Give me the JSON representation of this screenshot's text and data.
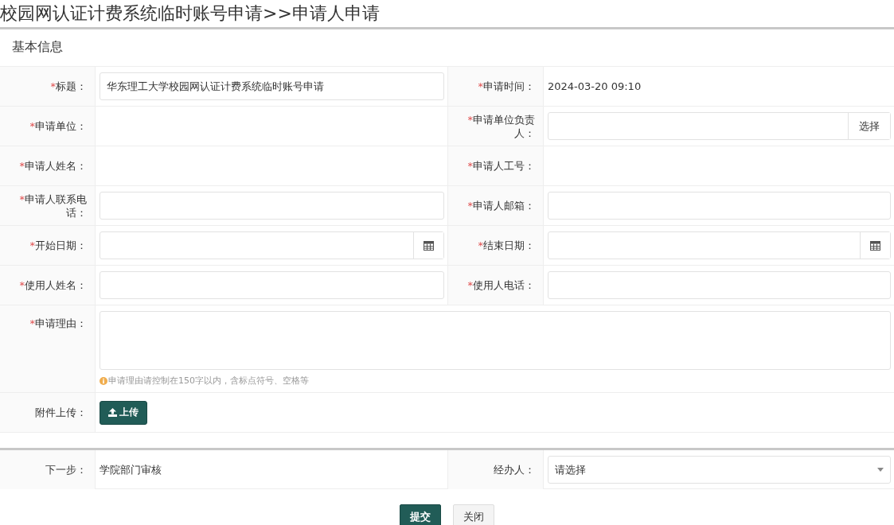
{
  "page_title": "校园网认证计费系统临时账号申请>>申请人申请",
  "section_title": "基本信息",
  "rows": [
    {
      "cells": [
        {
          "mark": "*",
          "label": "标题：",
          "kind": "input",
          "value": "华东理工大学校园网认证计费系统临时账号申请"
        },
        {
          "mark": "*",
          "label": "申请时间：",
          "kind": "text",
          "value": "2024-03-20 09:10"
        }
      ]
    },
    {
      "cells": [
        {
          "mark": "*",
          "label": "申请单位：",
          "kind": "empty"
        },
        {
          "mark": "*",
          "label": "申请单位负责人：",
          "kind": "picker",
          "button": "选择"
        }
      ]
    },
    {
      "cells": [
        {
          "mark": "*",
          "label": "申请人姓名：",
          "kind": "empty"
        },
        {
          "mark": "*",
          "label": "申请人工号：",
          "kind": "empty"
        }
      ]
    },
    {
      "cells": [
        {
          "mark": "*",
          "label": "申请人联系电话：",
          "kind": "input"
        },
        {
          "mark": "*",
          "label": "申请人邮箱：",
          "kind": "input"
        }
      ]
    },
    {
      "cells": [
        {
          "mark": "*",
          "label": "开始日期：",
          "kind": "date"
        },
        {
          "mark": "*",
          "label": "结束日期：",
          "kind": "date"
        }
      ]
    },
    {
      "cells": [
        {
          "mark": "*",
          "label": "使用人姓名：",
          "kind": "input"
        },
        {
          "mark": "*",
          "label": "使用人电话：",
          "kind": "input"
        }
      ]
    },
    {
      "cells": [
        {
          "mark": "*",
          "label": "申请理由：",
          "kind": "textarea",
          "hint": "申请理由请控制在150字以内，含标点符号、空格等"
        }
      ]
    },
    {
      "cells": [
        {
          "label": "附件上传：",
          "kind": "upload",
          "button": "上传"
        }
      ]
    }
  ],
  "workflow": {
    "next_label": "下一步：",
    "next_value": "学院部门审核",
    "handler_label": "经办人：",
    "handler_placeholder": "请选择"
  },
  "buttons": [
    {
      "label": "提交",
      "kind": "primary"
    },
    {
      "label": "关闭",
      "kind": "default"
    }
  ]
}
